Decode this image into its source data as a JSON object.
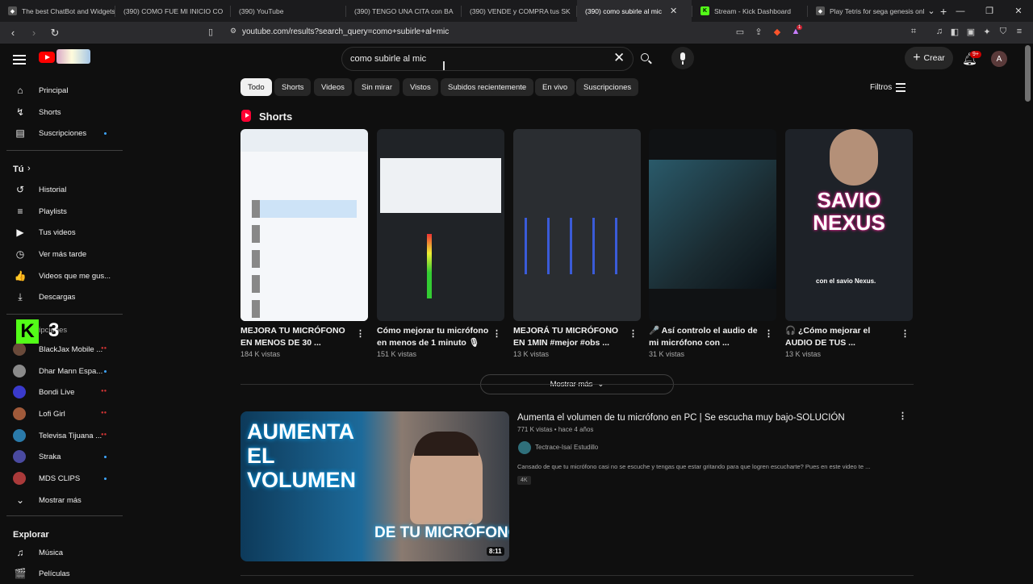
{
  "browser": {
    "tabs": [
      {
        "title": "The best ChatBot and Widgets",
        "icon": "gen",
        "active": false
      },
      {
        "title": "(390) COMO FUE MI INICIO CO",
        "icon": "yt",
        "active": false
      },
      {
        "title": "(390) YouTube",
        "icon": "yt",
        "active": false
      },
      {
        "title": "(390) TENGO UNA CITA con BA",
        "icon": "yt",
        "active": false
      },
      {
        "title": "(390) VENDE y COMPRA tus SK",
        "icon": "yt",
        "active": false
      },
      {
        "title": "(390) como subirle al mic",
        "icon": "yt",
        "active": true
      },
      {
        "title": "Stream - Kick Dashboard",
        "icon": "kick",
        "active": false
      },
      {
        "title": "Play Tetris for sega genesis onl",
        "icon": "gen",
        "active": false
      }
    ],
    "url": "youtube.com/results?search_query=como+subirle+al+mic",
    "notification_count": "1"
  },
  "youtube": {
    "search": {
      "value": "como subirle al mic"
    },
    "header": {
      "create_label": "Crear",
      "notif_badge": "9+",
      "avatar_letter": "A"
    },
    "sidebar": {
      "main": [
        {
          "label": "Principal",
          "icon": "home-icon",
          "glyph": "⌂"
        },
        {
          "label": "Shorts",
          "icon": "shorts-icon",
          "glyph": "↯"
        },
        {
          "label": "Suscripciones",
          "icon": "subscriptions-icon",
          "glyph": "▤"
        }
      ],
      "you_heading": "Tú",
      "you": [
        {
          "label": "Historial",
          "icon": "history-icon",
          "glyph": "↺"
        },
        {
          "label": "Playlists",
          "icon": "playlists-icon",
          "glyph": "≡"
        },
        {
          "label": "Tus videos",
          "icon": "your-videos-icon",
          "glyph": "▶"
        },
        {
          "label": "Ver más tarde",
          "icon": "watch-later-icon",
          "glyph": "◷"
        },
        {
          "label": "Videos que me gus...",
          "icon": "like-icon",
          "glyph": "👍"
        },
        {
          "label": "Descargas",
          "icon": "download-icon",
          "glyph": "⤓"
        }
      ],
      "subs_heading": "Suscripciones",
      "subs": [
        {
          "label": "BlackJax Mobile ...",
          "color": "#6a4a3a",
          "status": "live"
        },
        {
          "label": "Dhar Mann Espa...",
          "color": "#8a8a8a",
          "status": "dot"
        },
        {
          "label": "Bondi Live",
          "color": "#3a3acc",
          "status": "live"
        },
        {
          "label": "Lofi Girl",
          "color": "#a05a3a",
          "status": "live"
        },
        {
          "label": "Televisa Tijuana ...",
          "color": "#2a7aaa",
          "status": "live"
        },
        {
          "label": "Straka",
          "color": "#4a4aa0",
          "status": "dot"
        },
        {
          "label": "MDS CLIPS",
          "color": "#aa3a3a",
          "status": "dot"
        }
      ],
      "show_more": "Mostrar más",
      "explore_heading": "Explorar",
      "explore": [
        {
          "label": "Música",
          "icon": "music-icon",
          "glyph": "♫"
        },
        {
          "label": "Películas",
          "icon": "movies-icon",
          "glyph": "🎬"
        }
      ],
      "live_mark": "●●"
    },
    "chips": [
      "Todo",
      "Shorts",
      "Videos",
      "Sin mirar",
      "Vistos",
      "Subidos recientemente",
      "En vivo",
      "Suscripciones"
    ],
    "filters_label": "Filtros",
    "shorts_section": {
      "title": "Shorts",
      "items": [
        {
          "title": "MEJORA TU MICRÓFONO EN MENOS DE 30 ...",
          "views": "184 K vistas",
          "bg": "#e9eef3"
        },
        {
          "title": "Cómo mejorar tu micrófono en menos de 1 minuto 🎙",
          "views": "151 K vistas",
          "bg": "#202327"
        },
        {
          "title": "MEJORÁ TU MICRÓFONO EN 1MIN #mejor #obs ...",
          "views": "13 K vistas",
          "bg": "#2a2d31"
        },
        {
          "title": "🎤 Así controlo el audio de mi micrófono con ...",
          "views": "31 K vistas",
          "bg": "#101214"
        },
        {
          "title": "🎧 ¿Cómo mejorar el AUDIO DE TUS ...",
          "views": "13 K vistas",
          "bg": "#1e2228"
        }
      ],
      "more_label": "Mostrar más",
      "overlay_text": "SAVIO NEXUS",
      "caption": "con el savio Nexus."
    },
    "video": {
      "title": "Aumenta el volumen de tu micrófono en PC | Se escucha muy bajo-SOLUCIÓN",
      "meta": "771 K vistas • hace 4 años",
      "channel": "Tectrace-Isaí Estudillo",
      "description": "Cansado de que tu micrófono casi no se escuche y tengas que estar gritando para que logren escucharte? Pues en este video te ...",
      "badge": "4K",
      "duration": "8:11",
      "thumb_text_top": "AUMENTA EL VOLUMEN",
      "thumb_text_bottom": "DE TU MICRÓFONO"
    },
    "overlay": {
      "k": "K",
      "num": "3"
    }
  }
}
